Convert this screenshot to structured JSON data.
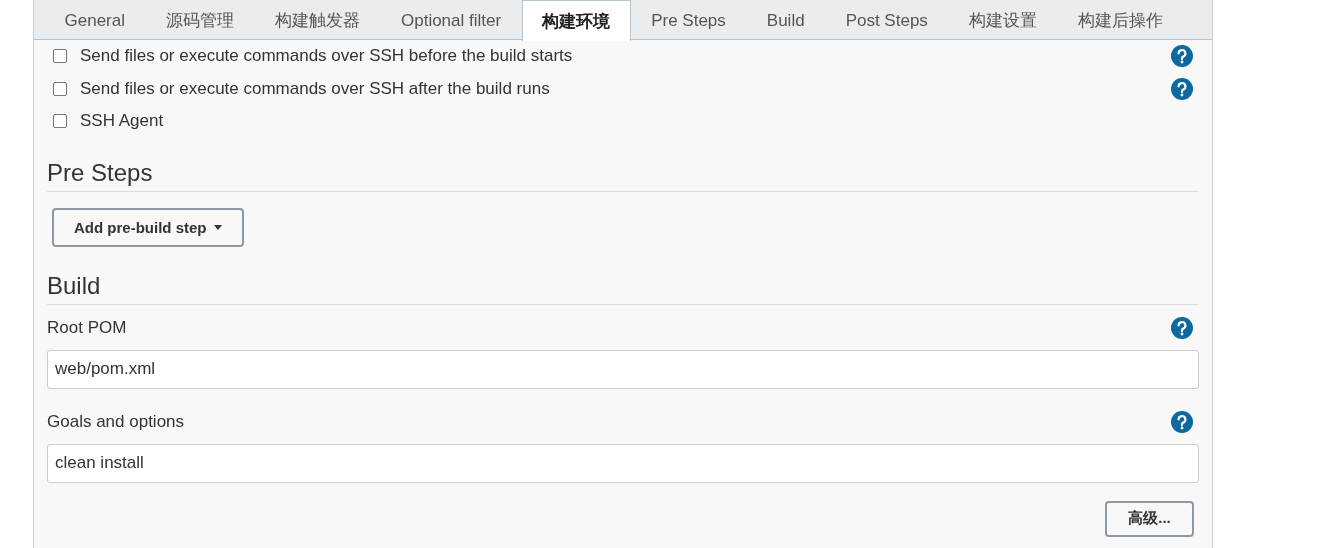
{
  "tabs": [
    {
      "label": "General",
      "selected": false
    },
    {
      "label": "源码管理",
      "selected": false
    },
    {
      "label": "构建触发器",
      "selected": false
    },
    {
      "label": "Optional filter",
      "selected": false
    },
    {
      "label": "构建环境",
      "selected": true
    },
    {
      "label": "Pre Steps",
      "selected": false
    },
    {
      "label": "Build",
      "selected": false
    },
    {
      "label": "Post Steps",
      "selected": false
    },
    {
      "label": "构建设置",
      "selected": false
    },
    {
      "label": "构建后操作",
      "selected": false
    }
  ],
  "options": [
    {
      "label": "Send files or execute commands over SSH before the build starts",
      "checked": false,
      "help": true
    },
    {
      "label": "Send files or execute commands over SSH after the build runs",
      "checked": false,
      "help": true
    },
    {
      "label": "SSH Agent",
      "checked": false,
      "help": false
    }
  ],
  "sections": [
    {
      "title": "Pre Steps",
      "items": [
        {
          "kind": "dropdown-button",
          "label": "Add pre-build step"
        }
      ]
    },
    {
      "title": "Build",
      "items": [
        {
          "kind": "field",
          "label": "Root POM",
          "value": "web/pom.xml",
          "help": true
        },
        {
          "kind": "field",
          "label": "Goals and options",
          "value": "clean install",
          "help": true
        },
        {
          "kind": "button",
          "label": "高级..."
        }
      ]
    }
  ]
}
